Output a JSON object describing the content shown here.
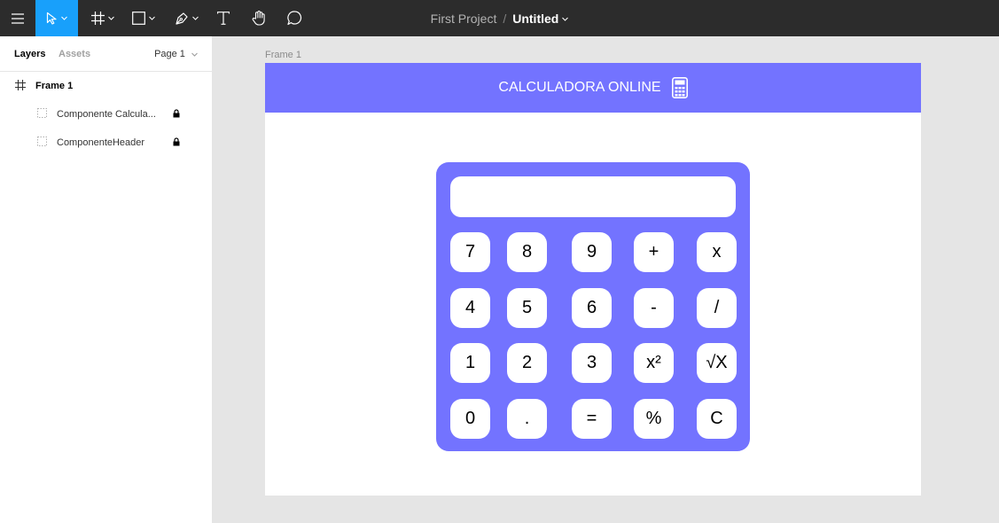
{
  "toolbar": {
    "tools": [
      {
        "name": "main-menu",
        "icon": "hamburger-icon"
      },
      {
        "name": "move-tool",
        "icon": "pointer-icon",
        "active": true
      },
      {
        "name": "frame-tool",
        "icon": "hash-icon"
      },
      {
        "name": "shape-tool",
        "icon": "rectangle-icon"
      },
      {
        "name": "pen-tool",
        "icon": "pen-icon"
      },
      {
        "name": "text-tool",
        "icon": "text-icon"
      },
      {
        "name": "hand-tool",
        "icon": "hand-icon"
      },
      {
        "name": "comment-tool",
        "icon": "comment-icon"
      }
    ],
    "project_name": "First Project",
    "separator": "/",
    "file_name": "Untitled",
    "accent_color": "#18a0fb",
    "background_color": "#2c2c2c"
  },
  "left_panel": {
    "tabs": {
      "layers": "Layers",
      "assets": "Assets"
    },
    "page": "Page 1",
    "layers": [
      {
        "label": "Frame 1",
        "icon": "frame-hash-icon",
        "level": 0
      },
      {
        "label": "Componente Calcula...",
        "icon": "component-dashed-icon",
        "level": 1,
        "locked": true
      },
      {
        "label": "ComponenteHeader",
        "icon": "component-dashed-icon",
        "level": 1,
        "locked": true
      }
    ]
  },
  "canvas": {
    "frame_label": "Frame 1",
    "header": {
      "title": "CALCULADORA ONLINE",
      "icon": "calculator-icon",
      "color": "#7373ff"
    },
    "calculator": {
      "color": "#7373ff",
      "display_value": "",
      "keys": [
        [
          "7",
          "8",
          "9",
          "+",
          "x"
        ],
        [
          "4",
          "5",
          "6",
          "-",
          "/"
        ],
        [
          "1",
          "2",
          "3",
          "x²",
          "√X"
        ],
        [
          "0",
          ".",
          "=",
          "%",
          "C"
        ]
      ]
    }
  }
}
